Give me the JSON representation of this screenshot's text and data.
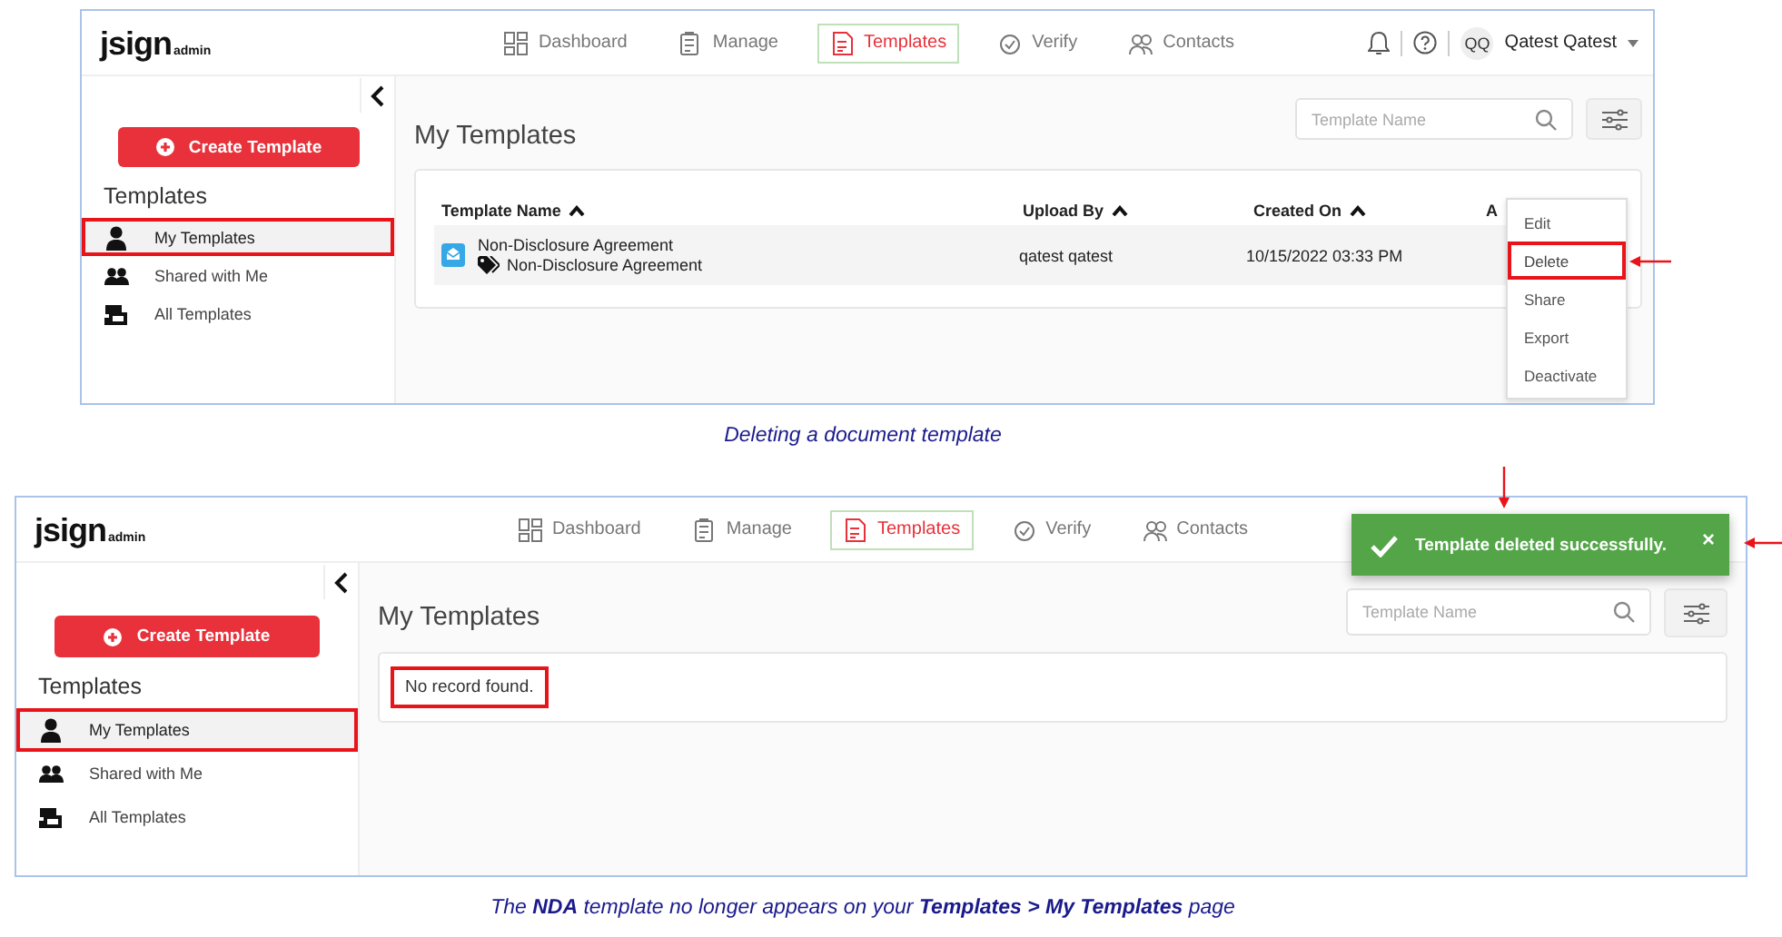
{
  "screenshots": [
    {
      "header": {
        "logo": "jsign",
        "logo_sub": "admin",
        "nav": [
          {
            "kind": "dashboard",
            "label": "Dashboard",
            "selected": false
          },
          {
            "kind": "manage",
            "label": "Manage",
            "selected": false
          },
          {
            "kind": "templates",
            "label": "Templates",
            "selected": true
          },
          {
            "kind": "verify",
            "label": "Verify",
            "selected": false
          },
          {
            "kind": "contacts",
            "label": "Contacts",
            "selected": false
          }
        ],
        "user": {
          "initials": "QQ",
          "name": "Qatest Qatest"
        }
      },
      "sidebar": {
        "create_button": "Create Template",
        "heading": "Templates",
        "items": [
          {
            "kind": "mine",
            "label": "My Templates",
            "selected": true,
            "highlighted": true
          },
          {
            "kind": "shared",
            "label": "Shared with Me",
            "selected": false,
            "highlighted": false
          },
          {
            "kind": "all",
            "label": "All Templates",
            "selected": false,
            "highlighted": false
          }
        ]
      },
      "content": {
        "title": "My Templates",
        "search": {
          "placeholder": "Template Name"
        },
        "table": {
          "columns": [
            {
              "label": "Template Name",
              "sorted": true
            },
            {
              "label": "Upload By",
              "sorted": true
            },
            {
              "label": "Created On",
              "sorted": true
            },
            {
              "label": "A",
              "sorted": false
            }
          ],
          "rows": [
            {
              "name": "Non-Disclosure Agreement",
              "tag": "Non-Disclosure Agreement",
              "upload_by": "qatest qatest",
              "created_on": "10/15/2022 03:33 PM"
            }
          ]
        },
        "action_menu": [
          {
            "label": "Edit",
            "highlighted": false
          },
          {
            "label": "Delete",
            "highlighted": true
          },
          {
            "label": "Share",
            "highlighted": false
          },
          {
            "label": "Export",
            "highlighted": false
          },
          {
            "label": "Deactivate",
            "highlighted": false
          }
        ]
      },
      "caption": "Deleting a document template"
    },
    {
      "header": {
        "logo": "jsign",
        "logo_sub": "admin",
        "nav": [
          {
            "kind": "dashboard",
            "label": "Dashboard",
            "selected": false
          },
          {
            "kind": "manage",
            "label": "Manage",
            "selected": false
          },
          {
            "kind": "templates",
            "label": "Templates",
            "selected": true
          },
          {
            "kind": "verify",
            "label": "Verify",
            "selected": false
          },
          {
            "kind": "contacts",
            "label": "Contacts",
            "selected": false
          }
        ]
      },
      "toast": {
        "message": "Template deleted successfully.",
        "close": "×"
      },
      "sidebar": {
        "create_button": "Create Template",
        "heading": "Templates",
        "items": [
          {
            "kind": "mine",
            "label": "My Templates",
            "selected": true,
            "highlighted": true
          },
          {
            "kind": "shared",
            "label": "Shared with Me",
            "selected": false,
            "highlighted": false
          },
          {
            "kind": "all",
            "label": "All Templates",
            "selected": false,
            "highlighted": false
          }
        ]
      },
      "content": {
        "title": "My Templates",
        "search": {
          "placeholder": "Template Name"
        },
        "empty_message": {
          "text": "No record found.",
          "highlighted": true
        }
      },
      "caption": "The **NDA** template no longer appears on your **Templates > My Templates** page"
    }
  ]
}
